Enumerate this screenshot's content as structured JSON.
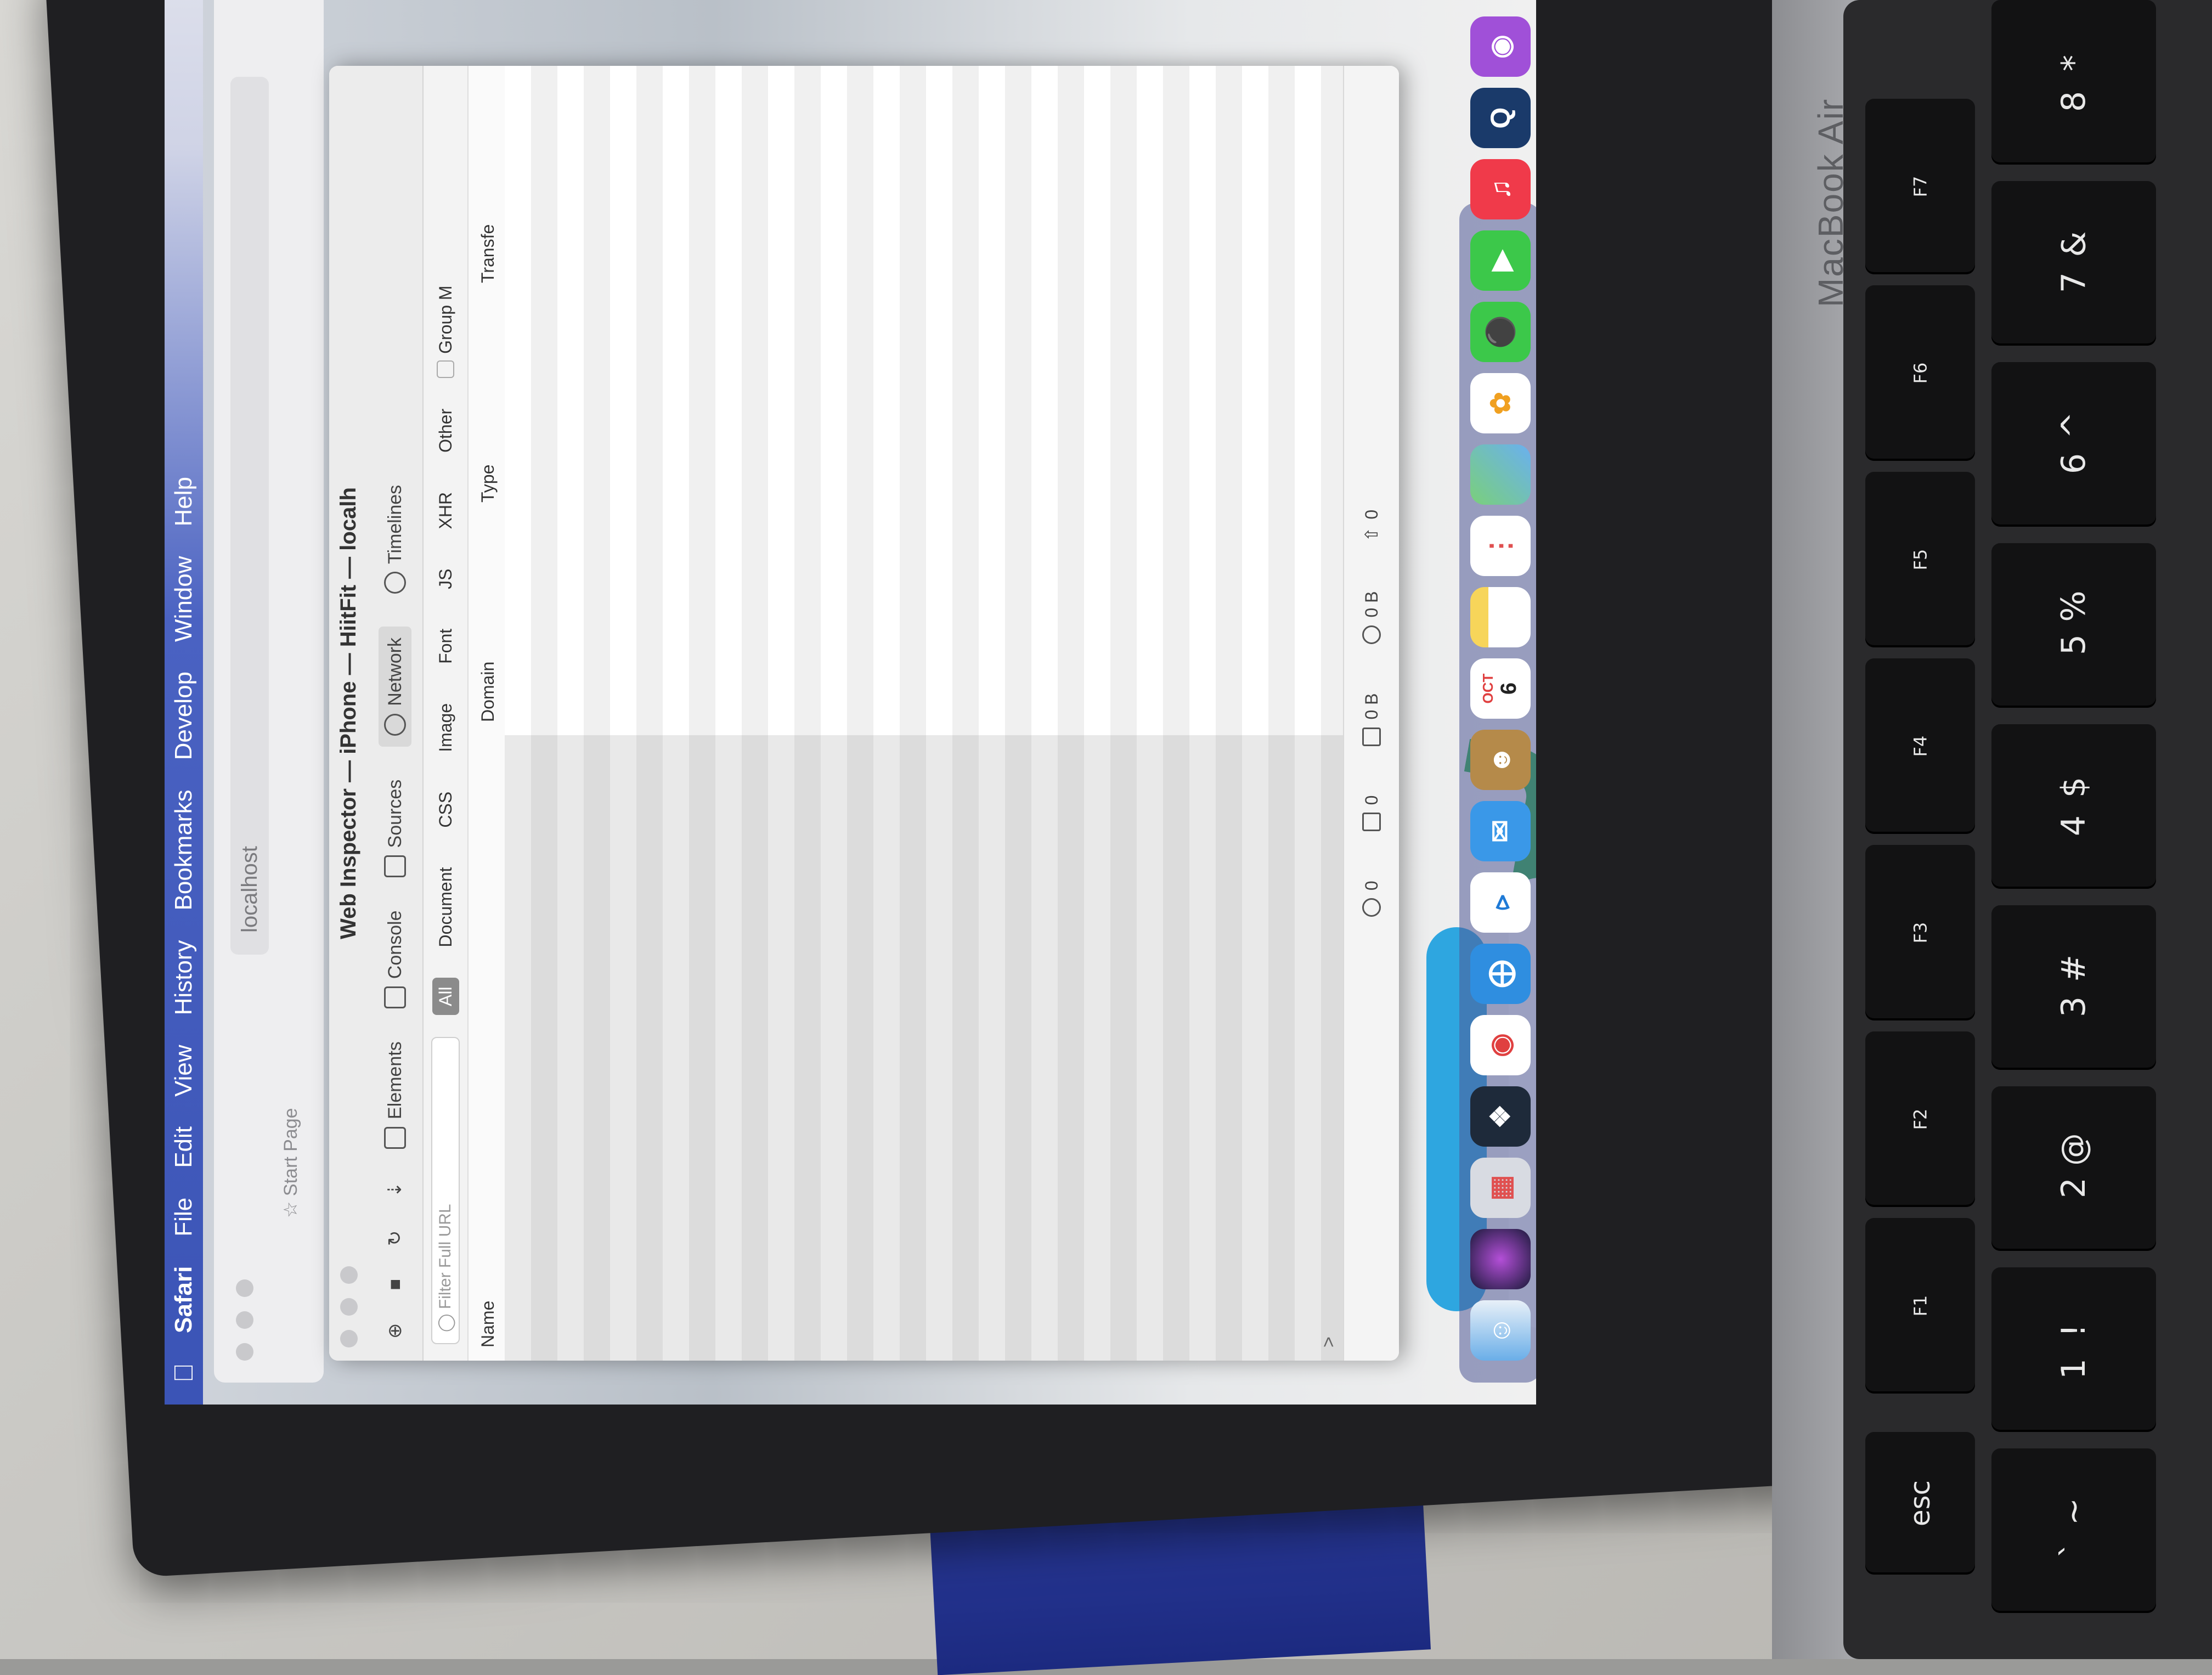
{
  "menubar": {
    "app": "Safari",
    "items": [
      "File",
      "Edit",
      "View",
      "History",
      "Bookmarks",
      "Develop",
      "Window",
      "Help"
    ]
  },
  "safari": {
    "address_host": "localhost",
    "favorites_label": "Start Page"
  },
  "inspector": {
    "title": "Web Inspector — iPhone — HiitFit — localh",
    "tabs": [
      {
        "label": "Elements",
        "icon": "elements-icon"
      },
      {
        "label": "Console",
        "icon": "console-icon"
      },
      {
        "label": "Sources",
        "icon": "sources-icon"
      },
      {
        "label": "Network",
        "icon": "network-icon"
      },
      {
        "label": "Timelines",
        "icon": "timelines-icon"
      }
    ],
    "filter_placeholder": "Filter Full URL",
    "type_filters": [
      "All",
      "Document",
      "CSS",
      "Image",
      "Font",
      "JS",
      "XHR",
      "Other"
    ],
    "group_label": "Group M",
    "columns": [
      "Name",
      "Domain",
      "Type",
      "Transfe"
    ],
    "status": {
      "requests": "0",
      "resources": "0",
      "size": "0 B",
      "transferred": "0 B",
      "uploaded": "0"
    },
    "console_prompt": ">"
  },
  "dock": {
    "icons": [
      "finder-icon",
      "siri-icon",
      "launchpad-icon",
      "davinci-icon",
      "chrome-icon",
      "safari-icon",
      "vscode-icon",
      "mail-icon",
      "contacts-icon",
      "calendar-icon",
      "notes-icon",
      "reminders-icon",
      "maps-icon",
      "photos-icon",
      "messages-icon",
      "facetime-icon",
      "music-icon",
      "quicktime-icon",
      "podcasts-icon"
    ],
    "calendar_month": "OCT",
    "calendar_day": "6"
  },
  "keyboard": {
    "brand": "MacBook Air",
    "fn_row": [
      "esc",
      "F1",
      "F2",
      "F3",
      "F4",
      "F5",
      "F6",
      "F7"
    ],
    "num_row": [
      {
        "top": "~",
        "bottom": "`"
      },
      {
        "top": "!",
        "bottom": "1"
      },
      {
        "top": "@",
        "bottom": "2"
      },
      {
        "top": "#",
        "bottom": "3"
      },
      {
        "top": "$",
        "bottom": "4"
      },
      {
        "top": "%",
        "bottom": "5"
      },
      {
        "top": "^",
        "bottom": "6"
      },
      {
        "top": "&",
        "bottom": "7"
      },
      {
        "top": "*",
        "bottom": "8"
      }
    ]
  }
}
